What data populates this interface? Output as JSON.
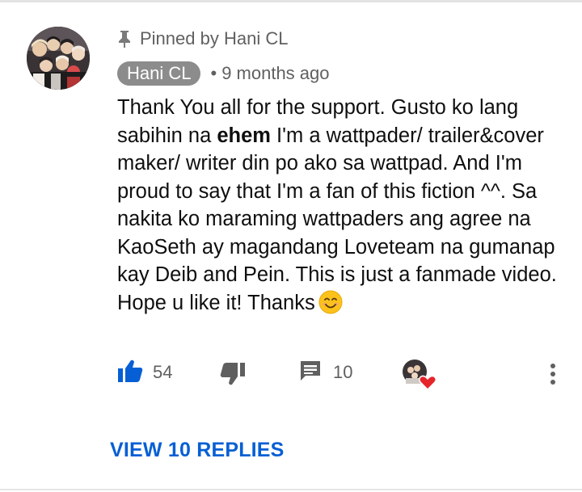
{
  "pinned": {
    "text": "Pinned by Hani CL"
  },
  "author": {
    "name": "Hani CL"
  },
  "meta": {
    "separator": "•",
    "timestamp": "9 months ago"
  },
  "comment": {
    "part1": "Thank You all for the support. Gusto ko lang sabihin na ",
    "bold": "ehem",
    "part2": " I'm a wattpader/ trailer&cover maker/ writer din po ako sa wattpad. And I'm proud to say that I'm a fan of this fiction ^^. Sa nakita ko maraming wattpaders ang agree na KaoSeth ay magandang Loveteam na gumanap kay Deib and Pein. This is just a fanmade video. Hope u like it! Thanks"
  },
  "actions": {
    "likes": "54",
    "replies": "10"
  },
  "view_replies_label": "VIEW 10 REPLIES",
  "colors": {
    "link": "#065fd4",
    "like": "#065fd4",
    "heart": "#e5252a",
    "muted": "#606060"
  },
  "icons": [
    "pin-icon",
    "thumbs-up-icon",
    "thumbs-down-icon",
    "reply-comment-icon",
    "creator-heart-icon",
    "more-vert-icon",
    "smiling-face-emoji"
  ]
}
